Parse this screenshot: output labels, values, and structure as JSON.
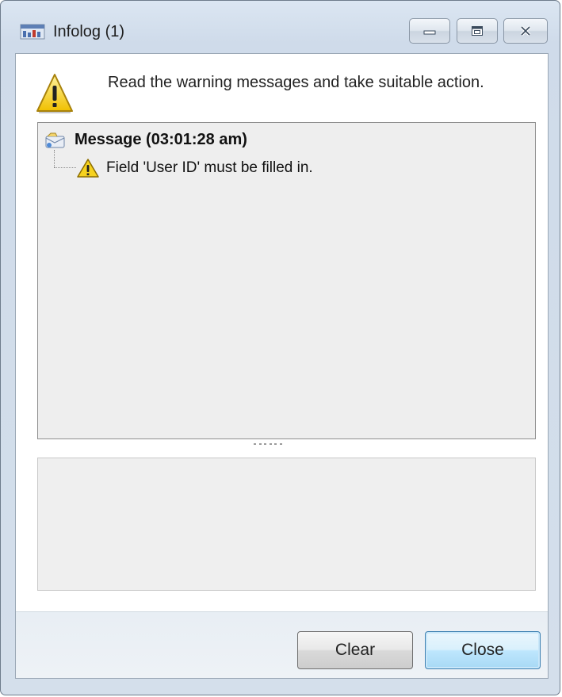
{
  "window": {
    "title": "Infolog (1)"
  },
  "header": {
    "message": "Read the warning messages and take suitable action."
  },
  "tree": {
    "root_label": "Message (03:01:28 am)",
    "items": [
      {
        "label": "Field 'User ID' must be filled in.",
        "severity": "warning"
      }
    ]
  },
  "buttons": {
    "clear_label": "Clear",
    "close_label": "Close"
  },
  "colors": {
    "warning_yellow": "#f6d21f",
    "default_button_border": "#3c7fb1"
  }
}
